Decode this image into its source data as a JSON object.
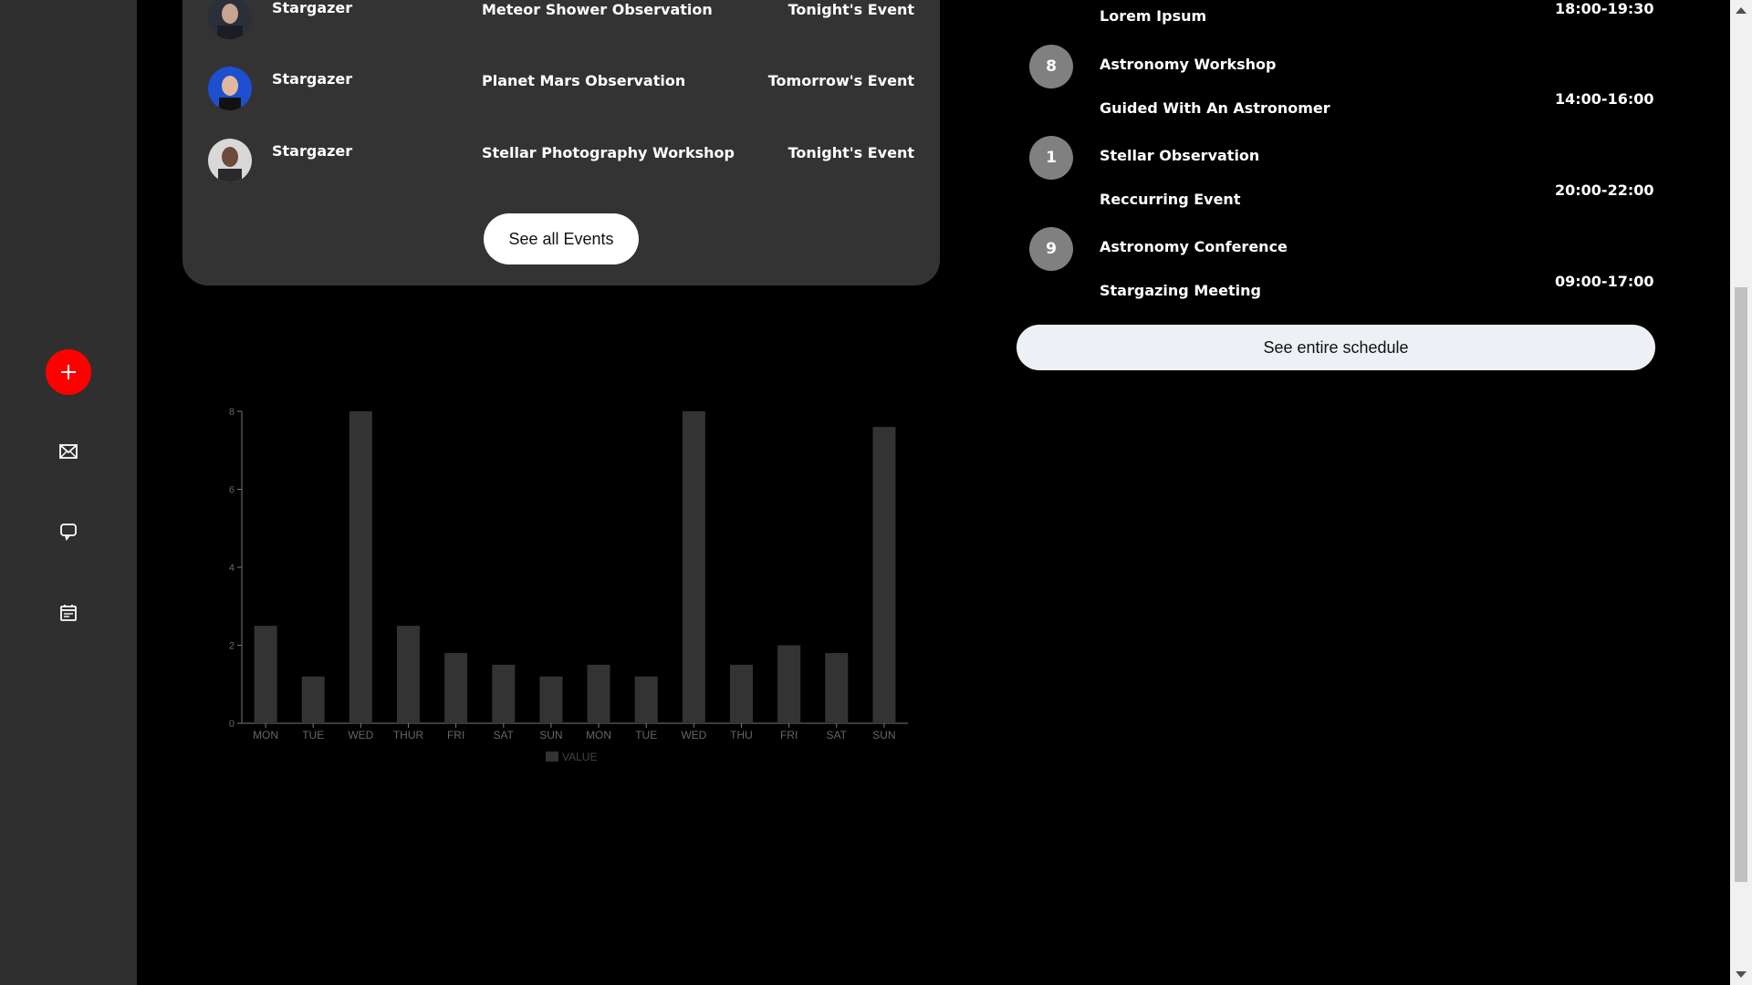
{
  "sidebar": {
    "items": [
      {
        "name": "add-icon"
      },
      {
        "name": "mail-icon"
      },
      {
        "name": "chat-icon"
      },
      {
        "name": "calendar-icon"
      }
    ],
    "accent": "#ff0000"
  },
  "events": {
    "items": [
      {
        "user": "Stargazer",
        "title": "Meteor Shower Observation",
        "when": "Tonight's Event"
      },
      {
        "user": "Stargazer",
        "title": "Planet Mars Observation",
        "when": "Tomorrow's Event"
      },
      {
        "user": "Stargazer",
        "title": "Stellar Photography Workshop",
        "when": "Tonight's Event"
      }
    ],
    "see_all_label": "See all Events"
  },
  "schedule": {
    "items": [
      {
        "num": "",
        "title": "",
        "subtitle": "Lorem Ipsum",
        "time": "18:00-19:30"
      },
      {
        "num": "8",
        "title": "Astronomy Workshop",
        "subtitle": "Guided With An Astronomer",
        "time": "14:00-16:00"
      },
      {
        "num": "1",
        "title": "Stellar Observation",
        "subtitle": "Reccurring Event",
        "time": "20:00-22:00"
      },
      {
        "num": "9",
        "title": "Astronomy Conference",
        "subtitle": "Stargazing Meeting",
        "time": "09:00-17:00"
      }
    ],
    "see_schedule_label": "See entire schedule"
  },
  "chart_data": {
    "type": "bar",
    "categories": [
      "MON",
      "TUE",
      "WED",
      "THUR",
      "FRI",
      "SAT",
      "SUN",
      "MON",
      "TUE",
      "WED",
      "THU",
      "FRI",
      "SAT",
      "SUN"
    ],
    "series": [
      {
        "name": "VALUE",
        "values": [
          2.5,
          1.2,
          8,
          2.5,
          1.8,
          1.5,
          1.2,
          1.5,
          1.2,
          8,
          1.5,
          2,
          1.8,
          7.6
        ]
      }
    ],
    "yticks": [
      0,
      2,
      4,
      6,
      8
    ],
    "ylim": [
      0,
      8
    ],
    "bar_color": "#333333",
    "legend": "bottom-center",
    "grid": false
  }
}
